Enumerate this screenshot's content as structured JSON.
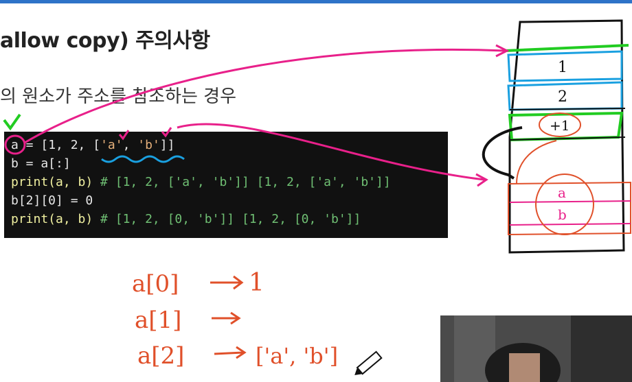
{
  "slide": {
    "title": "allow copy) 주의사항",
    "subtitle": "의 원소가 주소를 참조하는 경우"
  },
  "code": {
    "line1_var": "a",
    "line1_rest": " = [1, 2, [",
    "line1_s1": "'a'",
    "line1_mid": ", ",
    "line1_s2": "'b'",
    "line1_end": "]]",
    "line2": "b = a[:]",
    "line3_code": "print(a, b)",
    "line3_comment": " # [1, 2, ['a', 'b']] [1, 2, ['a', 'b']]",
    "line4": "b[2][0] = 0",
    "line5_code": "print(a, b)",
    "line5_comment": " # [1, 2, [0, 'b']] [1, 2, [0, 'b']]"
  },
  "memory": {
    "cells": [
      "1",
      "2",
      "+1"
    ],
    "inner_cells": [
      "a",
      "b"
    ]
  },
  "handwriting": {
    "line1_expr": "a[0]",
    "line1_value": "1",
    "line2_expr": "a[1]",
    "line3_expr": "a[2]",
    "line3_value": "['a', 'b']"
  },
  "colors": {
    "accent_bar": "#2e73c8",
    "pen_magenta": "#e8208a",
    "pen_green": "#22cc22",
    "pen_blue": "#1aa0e0",
    "pen_red": "#e0502a",
    "code_bg": "#111111"
  },
  "icons": {
    "pencil_cursor": "pencil-icon",
    "webcam": "webcam-feed"
  }
}
